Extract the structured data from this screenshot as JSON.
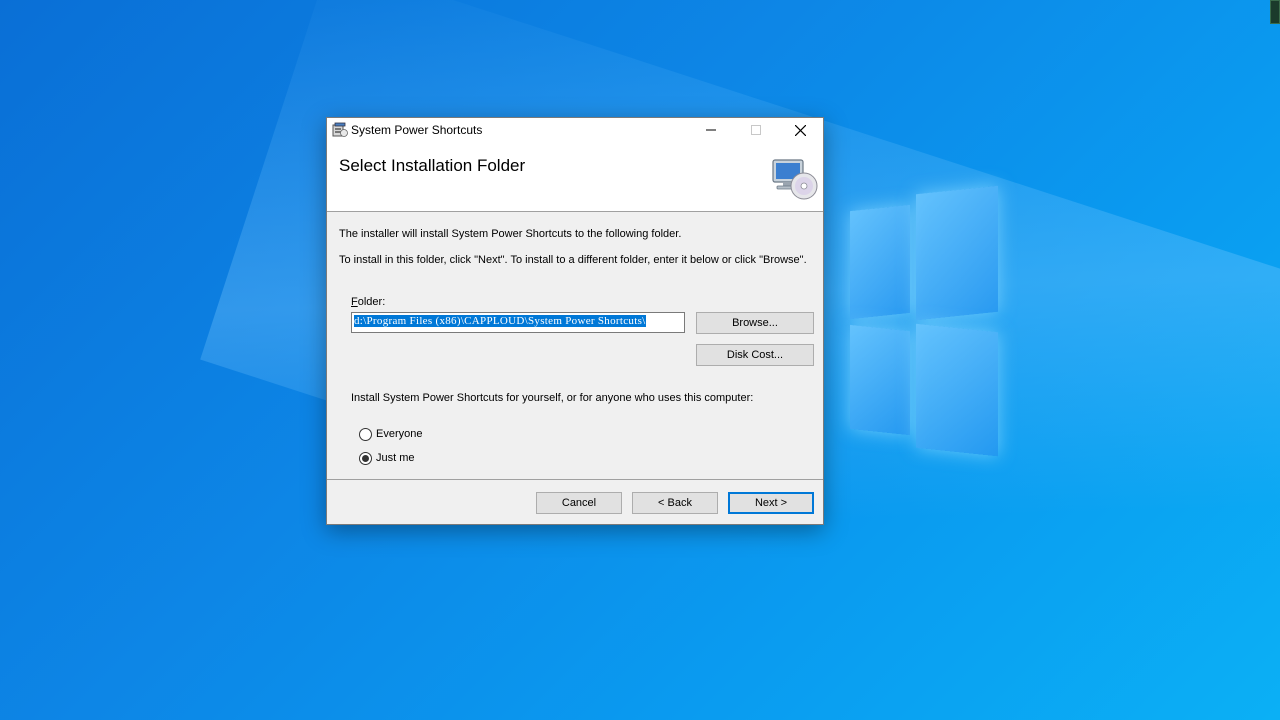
{
  "window": {
    "title": "System Power Shortcuts",
    "controls": {
      "minimize_icon": "minimize-icon",
      "maximize_icon": "maximize-icon",
      "close_icon": "close-icon"
    }
  },
  "banner": {
    "title": "Select Installation Folder",
    "icon": "computer-cd-icon"
  },
  "body": {
    "description_line1": "The installer will install System Power Shortcuts to the following folder.",
    "description_line2": "To install in this folder, click \"Next\". To install to a different folder, enter it below or click \"Browse\".",
    "folder_label_accel": "F",
    "folder_label_rest": "older:",
    "folder_value": "d:\\Program Files (x86)\\CAPPLOUD\\System Power Shortcuts\\",
    "browse_label": "Browse...",
    "disk_cost_label": "Disk Cost...",
    "install_question": "Install System Power Shortcuts for yourself, or for anyone who uses this computer:",
    "radio_options": [
      {
        "label": "Everyone",
        "selected": false
      },
      {
        "label": "Just me",
        "selected": true
      }
    ]
  },
  "footer": {
    "cancel_label": "Cancel",
    "back_label": "< Back",
    "next_label": "Next >"
  },
  "colors": {
    "desktop_accent": "#0a86e6",
    "selection": "#0078d7"
  }
}
